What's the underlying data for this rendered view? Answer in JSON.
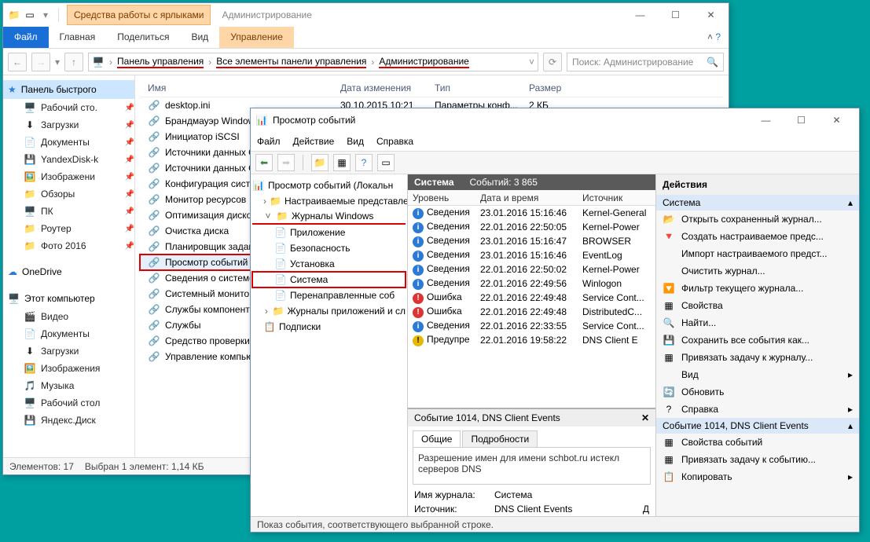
{
  "explorer": {
    "tool_tab": "Средства работы с ярлыками",
    "window_title": "Администрирование",
    "ribbon": {
      "file": "Файл",
      "home": "Главная",
      "share": "Поделиться",
      "view": "Вид",
      "manage": "Управление"
    },
    "breadcrumb": [
      "Панель управления",
      "Все элементы панели управления",
      "Администрирование"
    ],
    "search_placeholder": "Поиск: Администрирование",
    "columns": {
      "name": "Имя",
      "date": "Дата изменения",
      "type": "Тип",
      "size": "Размер"
    },
    "nav": {
      "quick_header": "Панель быстрого",
      "quick": [
        "Рабочий сто.",
        "Загрузки",
        "Документы",
        "YandexDisk-k",
        "Изображени",
        "Обзоры",
        "ПК",
        "Роутер",
        "Фото 2016"
      ],
      "onedrive": "OneDrive",
      "thispc_header": "Этот компьютер",
      "thispc": [
        "Видео",
        "Документы",
        "Загрузки",
        "Изображения",
        "Музыка",
        "Рабочий стол",
        "Яндекс.Диск"
      ]
    },
    "items": [
      {
        "name": "desktop.ini",
        "date": "30.10.2015 10:21",
        "type": "Параметры конф...",
        "size": "2 КБ"
      },
      {
        "name": "Брандмауэр Window"
      },
      {
        "name": "Инициатор iSCSI"
      },
      {
        "name": "Источники данных O"
      },
      {
        "name": "Источники данных O"
      },
      {
        "name": "Конфигурация систе"
      },
      {
        "name": "Монитор ресурсов"
      },
      {
        "name": "Оптимизация дисков"
      },
      {
        "name": "Очистка диска"
      },
      {
        "name": "Планировщик задани"
      },
      {
        "name": "Просмотр событий",
        "selected": true
      },
      {
        "name": "Сведения о системе"
      },
      {
        "name": "Системный монитор"
      },
      {
        "name": "Службы компоненто"
      },
      {
        "name": "Службы"
      },
      {
        "name": "Средство проверки"
      },
      {
        "name": "Управление компью"
      }
    ],
    "status": {
      "count": "Элементов: 17",
      "sel": "Выбран 1 элемент: 1,14 КБ"
    }
  },
  "evt": {
    "title": "Просмотр событий",
    "menu": [
      "Файл",
      "Действие",
      "Вид",
      "Справка"
    ],
    "tree": {
      "root": "Просмотр событий (Локальн",
      "custom": "Настраиваемые представле",
      "winlogs": "Журналы Windows",
      "winchildren": [
        "Приложение",
        "Безопасность",
        "Установка",
        "Система",
        "Перенаправленные соб"
      ],
      "applogs": "Журналы приложений и сл",
      "subs": "Подписки"
    },
    "center": {
      "header_label": "Система",
      "header_count": "Событий: 3 865",
      "cols": {
        "level": "Уровень",
        "dt": "Дата и время",
        "src": "Источник"
      },
      "rows": [
        {
          "lvl": "info",
          "level": "Сведения",
          "dt": "23.01.2016 15:16:46",
          "src": "Kernel-General"
        },
        {
          "lvl": "info",
          "level": "Сведения",
          "dt": "22.01.2016 22:50:05",
          "src": "Kernel-Power"
        },
        {
          "lvl": "info",
          "level": "Сведения",
          "dt": "23.01.2016 15:16:47",
          "src": "BROWSER"
        },
        {
          "lvl": "info",
          "level": "Сведения",
          "dt": "23.01.2016 15:16:46",
          "src": "EventLog"
        },
        {
          "lvl": "info",
          "level": "Сведения",
          "dt": "22.01.2016 22:50:02",
          "src": "Kernel-Power"
        },
        {
          "lvl": "info",
          "level": "Сведения",
          "dt": "22.01.2016 22:49:56",
          "src": "Winlogon"
        },
        {
          "lvl": "err",
          "level": "Ошибка",
          "dt": "22.01.2016 22:49:48",
          "src": "Service Cont..."
        },
        {
          "lvl": "err",
          "level": "Ошибка",
          "dt": "22.01.2016 22:49:48",
          "src": "DistributedC..."
        },
        {
          "lvl": "info",
          "level": "Сведения",
          "dt": "22.01.2016 22:33:55",
          "src": "Service Cont..."
        },
        {
          "lvl": "warn",
          "level": "Предупре",
          "dt": "22.01.2016 19:58:22",
          "src": "DNS Client E"
        }
      ],
      "detail_title": "Событие 1014, DNS Client Events",
      "tabs": {
        "general": "Общие",
        "details": "Подробности"
      },
      "detail_text": "Разрешение имен для имени schbot.ru истекл серверов DNS",
      "meta": {
        "log_label": "Имя журнала:",
        "log_value": "Система",
        "src_label": "Источник:",
        "src_value": "DNS Client Events",
        "date_label": "Д"
      }
    },
    "actions": {
      "title": "Действия",
      "group1": "Система",
      "items1": [
        "Открыть сохраненный журнал...",
        "Создать настраиваемое предс...",
        "Импорт настраиваемого предст...",
        "Очистить журнал...",
        "Фильтр текущего журнала...",
        "Свойства",
        "Найти...",
        "Сохранить все события как...",
        "Привязать задачу к журналу...",
        "Вид",
        "Обновить",
        "Справка"
      ],
      "group2": "Событие 1014, DNS Client Events",
      "items2": [
        "Свойства событий",
        "Привязать задачу к событию...",
        "Копировать"
      ]
    },
    "status": "Показ события, соответствующего выбранной строке."
  }
}
